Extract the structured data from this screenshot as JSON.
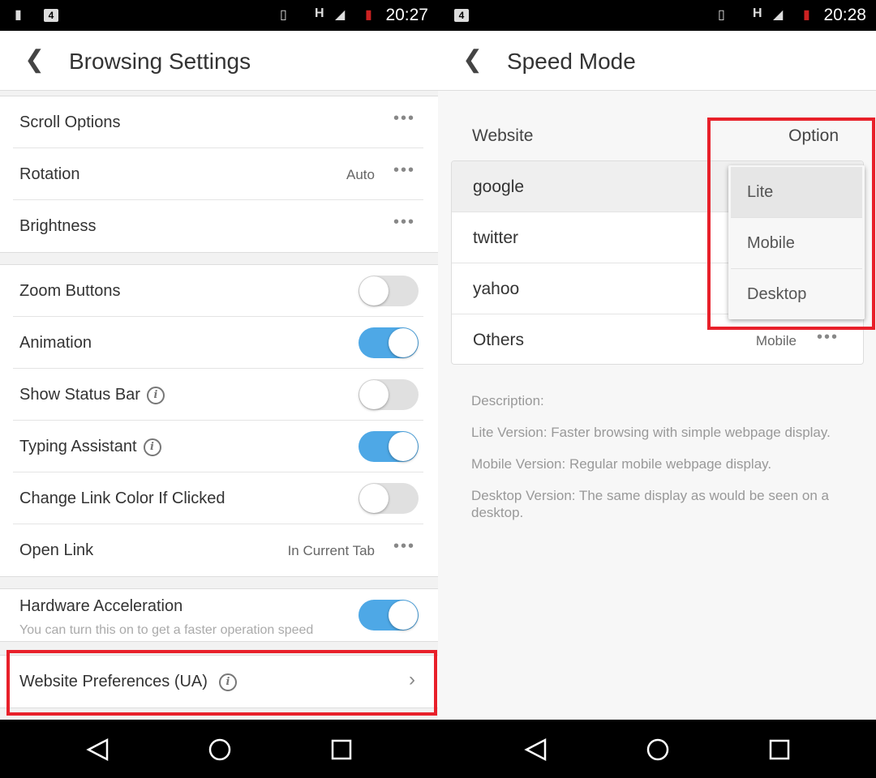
{
  "left": {
    "status": {
      "time": "20:27",
      "network": "H",
      "sim_badge": "4"
    },
    "title": "Browsing Settings",
    "section1": [
      {
        "label": "Scroll Options",
        "value": ""
      },
      {
        "label": "Rotation",
        "value": "Auto"
      },
      {
        "label": "Brightness",
        "value": ""
      }
    ],
    "section2": [
      {
        "label": "Zoom Buttons",
        "toggle": false
      },
      {
        "label": "Animation",
        "toggle": true
      },
      {
        "label": "Show Status Bar",
        "toggle": false,
        "info": true
      },
      {
        "label": "Typing Assistant",
        "toggle": true,
        "info": true
      },
      {
        "label": "Change Link Color If Clicked",
        "toggle": false
      },
      {
        "label": "Open Link",
        "value": "In Current Tab"
      }
    ],
    "hardware": {
      "label": "Hardware Acceleration",
      "sub": "You can turn this on to get a faster operation speed",
      "toggle": true
    },
    "website_prefs": {
      "label": "Website Preferences (UA)"
    }
  },
  "right": {
    "status": {
      "time": "20:28",
      "network": "H",
      "sim_badge": "4"
    },
    "title": "Speed Mode",
    "col_website": "Website",
    "col_option": "Option",
    "sites": [
      {
        "name": "google"
      },
      {
        "name": "twitter"
      },
      {
        "name": "yahoo"
      },
      {
        "name": "Others",
        "value": "Mobile"
      }
    ],
    "menu": [
      "Lite",
      "Mobile",
      "Desktop"
    ],
    "menu_selected": "Lite",
    "description": {
      "heading": "Description:",
      "lite": "Lite Version: Faster browsing with simple webpage display.",
      "mobile": "Mobile Version: Regular mobile webpage display.",
      "desktop": "Desktop Version: The same display as would be seen on a desktop."
    }
  },
  "colors": {
    "accent": "#4ea8e6",
    "highlight": "#e8202a"
  }
}
